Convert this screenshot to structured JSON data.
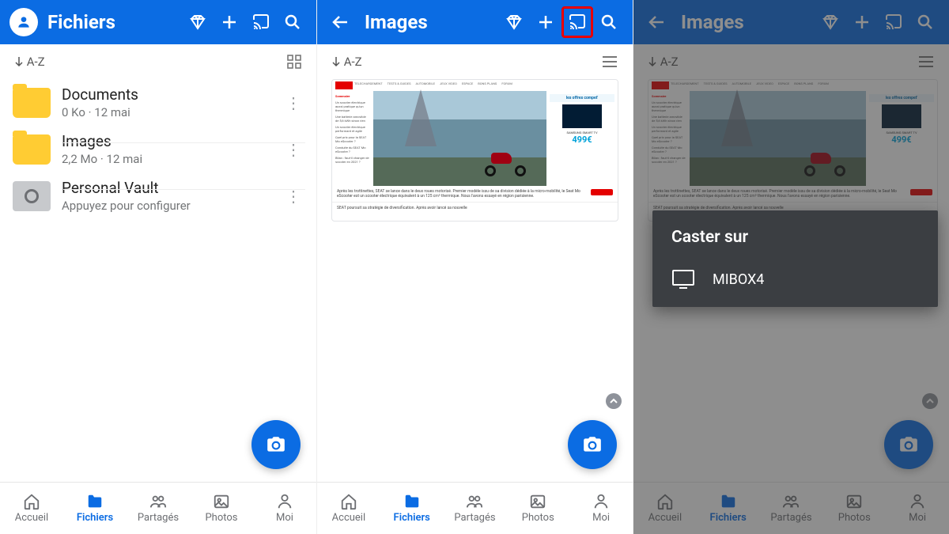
{
  "colors": {
    "brand": "#0b6ce3",
    "folder": "#ffcc33",
    "highlight": "#e80000",
    "dim": "rgba(50,50,50,.55)",
    "sheet": "#3b3e42"
  },
  "panel1": {
    "title": "Fichiers",
    "sort": "A-Z",
    "items": [
      {
        "name": "Documents",
        "meta": "0 Ko · 12 mai",
        "kind": "folder"
      },
      {
        "name": "Images",
        "meta": "2,2 Mo · 12 mai",
        "kind": "folder"
      },
      {
        "name": "Personal Vault",
        "meta": "Appuyez pour configurer",
        "kind": "vault"
      }
    ]
  },
  "panel2": {
    "title": "Images",
    "sort": "A-Z"
  },
  "panel3": {
    "title": "Images",
    "sort": "A-Z",
    "cast_title": "Caster sur",
    "cast_device": "MIBOX4"
  },
  "webmock": {
    "logo": "clubic",
    "nav": [
      "TELECHARGEMENT",
      "TESTS & GUIDES",
      "AUTOMOBILE",
      "JEUX VIDEO",
      "ESPACE",
      "BONS PLANS",
      "FORUM"
    ],
    "side_title": "Sommaire",
    "side": [
      "Un scooter électrique aussi pratique qu'un thermique",
      "Une batterie amovible de 5,6 kWh sinon rien",
      "Un scooter électrique performant et agile",
      "Quel prix pour la SEAT Mo eScooter ?",
      "Conduite du SEAT Mo eScooter ?",
      "Bilan : faut-il changer de scooter en 2021 ?"
    ],
    "ad_header": "les offres compet'",
    "ad_brand": "SAMSUNG SMART TV",
    "ad_price": "499€",
    "foot1": "Après les trottinettes, SEAT se lance dans le deux roues motorisé. Premier modèle issu de sa division dédiée à la micro-mobilité, le Seat Mo eScooter est un scooter électrique équivalent à un 125 cm³ thermique. Nous l'avons essayé en région parisienne.",
    "foot2": "SEAT poursuit sa stratégie de diversification. Après avoir lancé sa nouvelle"
  },
  "bottomnav": {
    "items": [
      {
        "label": "Accueil",
        "icon": "home"
      },
      {
        "label": "Fichiers",
        "icon": "folder",
        "active": true
      },
      {
        "label": "Partagés",
        "icon": "people"
      },
      {
        "label": "Photos",
        "icon": "photo"
      },
      {
        "label": "Moi",
        "icon": "person"
      }
    ]
  }
}
